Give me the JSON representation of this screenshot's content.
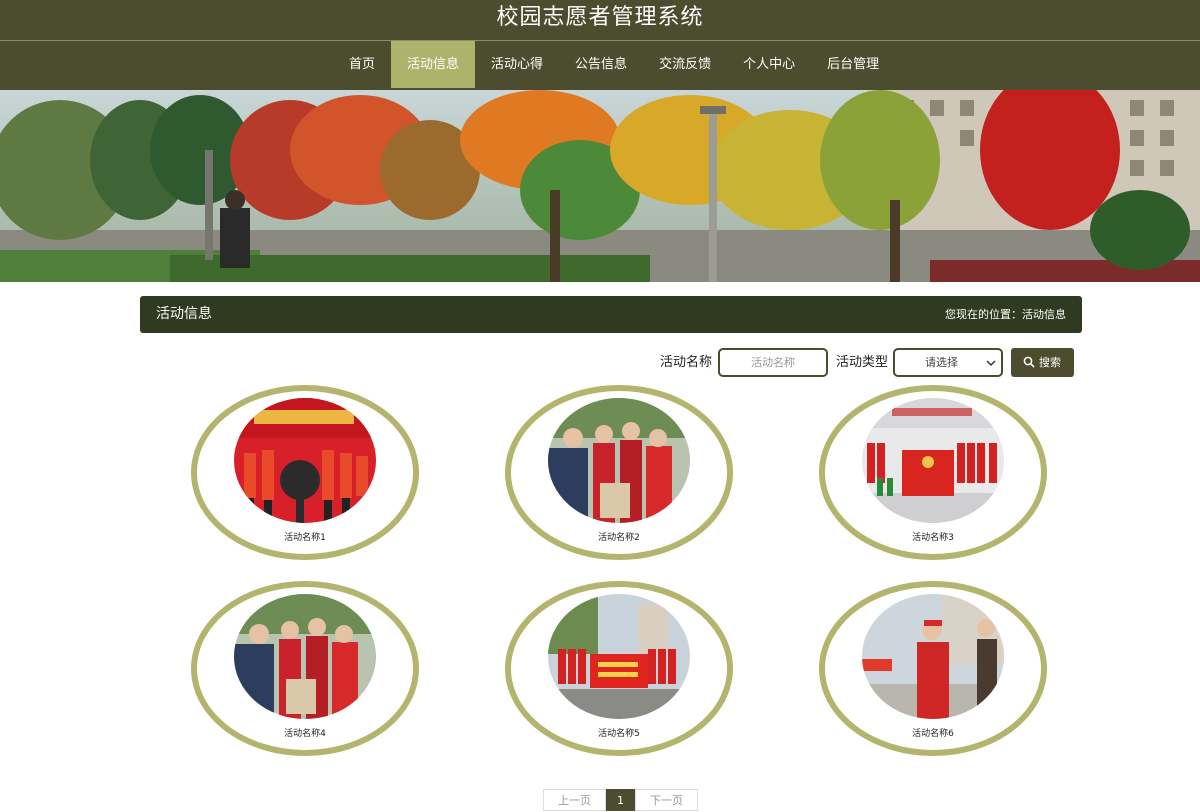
{
  "site": {
    "title": "校园志愿者管理系统"
  },
  "nav": {
    "items": [
      {
        "label": "首页",
        "active": false
      },
      {
        "label": "活动信息",
        "active": true
      },
      {
        "label": "活动心得",
        "active": false
      },
      {
        "label": "公告信息",
        "active": false
      },
      {
        "label": "交流反馈",
        "active": false
      },
      {
        "label": "个人中心",
        "active": false
      },
      {
        "label": "后台管理",
        "active": false
      }
    ]
  },
  "section": {
    "title": "活动信息",
    "location": "您现在的位置：活动信息"
  },
  "search": {
    "name_label": "活动名称",
    "name_placeholder": "活动名称",
    "type_label": "活动类型",
    "type_value": "请选择",
    "button_label": "搜索"
  },
  "activities": [
    {
      "name": "活动名称1"
    },
    {
      "name": "活动名称2"
    },
    {
      "name": "活动名称3"
    },
    {
      "name": "活动名称4"
    },
    {
      "name": "活动名称5"
    },
    {
      "name": "活动名称6"
    }
  ],
  "pagination": {
    "prev": "上一页",
    "current": "1",
    "next": "下一页"
  },
  "colors": {
    "header": "#4b4d2e",
    "nav_active": "#aeb36b",
    "ring": "#b4b46e",
    "section_bar": "#2f3a20"
  }
}
